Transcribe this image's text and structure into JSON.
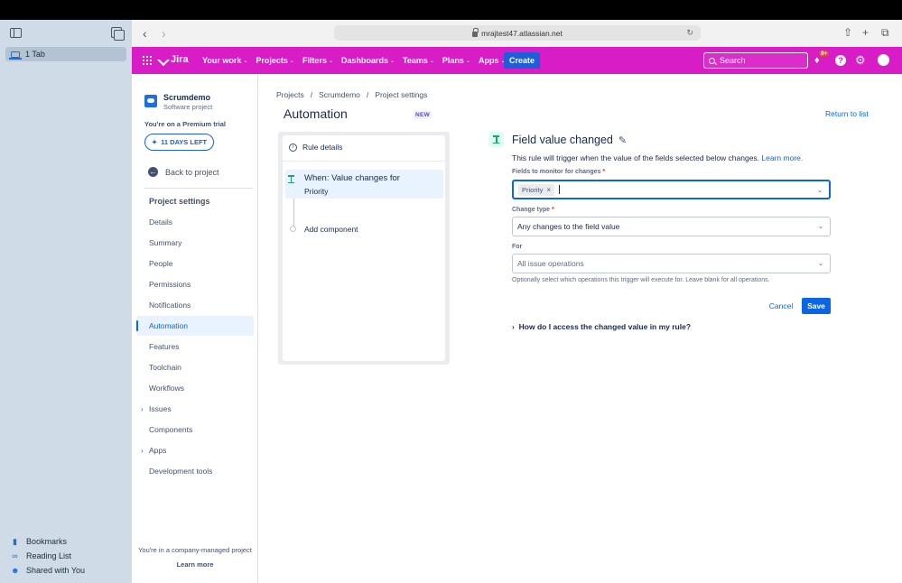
{
  "safari": {
    "url": "mrajtest47.atlassian.net",
    "tab_label": "1 Tab",
    "bottom_items": [
      {
        "label": "Bookmarks",
        "icon": "bookmark-icon"
      },
      {
        "label": "Reading List",
        "icon": "glasses-icon"
      },
      {
        "label": "Shared with You",
        "icon": "people-icon"
      }
    ]
  },
  "header": {
    "logo": "Jira",
    "nav": [
      {
        "label": "Your work"
      },
      {
        "label": "Projects"
      },
      {
        "label": "Filters"
      },
      {
        "label": "Dashboards"
      },
      {
        "label": "Teams"
      },
      {
        "label": "Plans"
      },
      {
        "label": "Apps"
      }
    ],
    "create_label": "Create",
    "search_placeholder": "Search",
    "notifications_badge": "9+",
    "brand_color": "#d81cc6",
    "accent_color": "#0c66e4"
  },
  "sidebar": {
    "project_name": "Scrumdemo",
    "project_type": "Software project",
    "trial_text": "You're on a Premium trial",
    "days_left": "11 DAYS LEFT",
    "back_label": "Back to project",
    "section_heading": "Project settings",
    "items": [
      {
        "label": "Details",
        "expandable": false,
        "active": false
      },
      {
        "label": "Summary",
        "expandable": false,
        "active": false
      },
      {
        "label": "People",
        "expandable": false,
        "active": false
      },
      {
        "label": "Permissions",
        "expandable": false,
        "active": false
      },
      {
        "label": "Notifications",
        "expandable": false,
        "active": false
      },
      {
        "label": "Automation",
        "expandable": false,
        "active": true
      },
      {
        "label": "Features",
        "expandable": false,
        "active": false
      },
      {
        "label": "Toolchain",
        "expandable": false,
        "active": false
      },
      {
        "label": "Workflows",
        "expandable": false,
        "active": false
      },
      {
        "label": "Issues",
        "expandable": true,
        "active": false
      },
      {
        "label": "Components",
        "expandable": false,
        "active": false
      },
      {
        "label": "Apps",
        "expandable": true,
        "active": false
      },
      {
        "label": "Development tools",
        "expandable": false,
        "active": false
      }
    ],
    "footer_text": "You're in a company-managed project",
    "footer_link": "Learn more"
  },
  "main": {
    "breadcrumbs": [
      "Projects",
      "Scrumdemo",
      "Project settings"
    ],
    "title": "Automation",
    "new_badge": "NEW",
    "return_link": "Return to list",
    "rule": {
      "details_label": "Rule details",
      "trigger_line1": "When: Value changes for",
      "trigger_line2": "Priority",
      "add_component": "Add component"
    },
    "config": {
      "title": "Field value changed",
      "description": "This rule will trigger when the value of the fields selected below changes.",
      "learn_more": "Learn more.",
      "fields_label": "Fields to monitor for changes",
      "fields_chip": "Priority",
      "change_type_label": "Change type",
      "change_type_value": "Any changes to the field value",
      "for_label": "For",
      "for_value": "All issue operations",
      "for_hint": "Optionally select which operations this trigger will execute for. Leave blank for all operations.",
      "cancel_label": "Cancel",
      "save_label": "Save",
      "howto_label": "How do I access the changed value in my rule?"
    }
  }
}
